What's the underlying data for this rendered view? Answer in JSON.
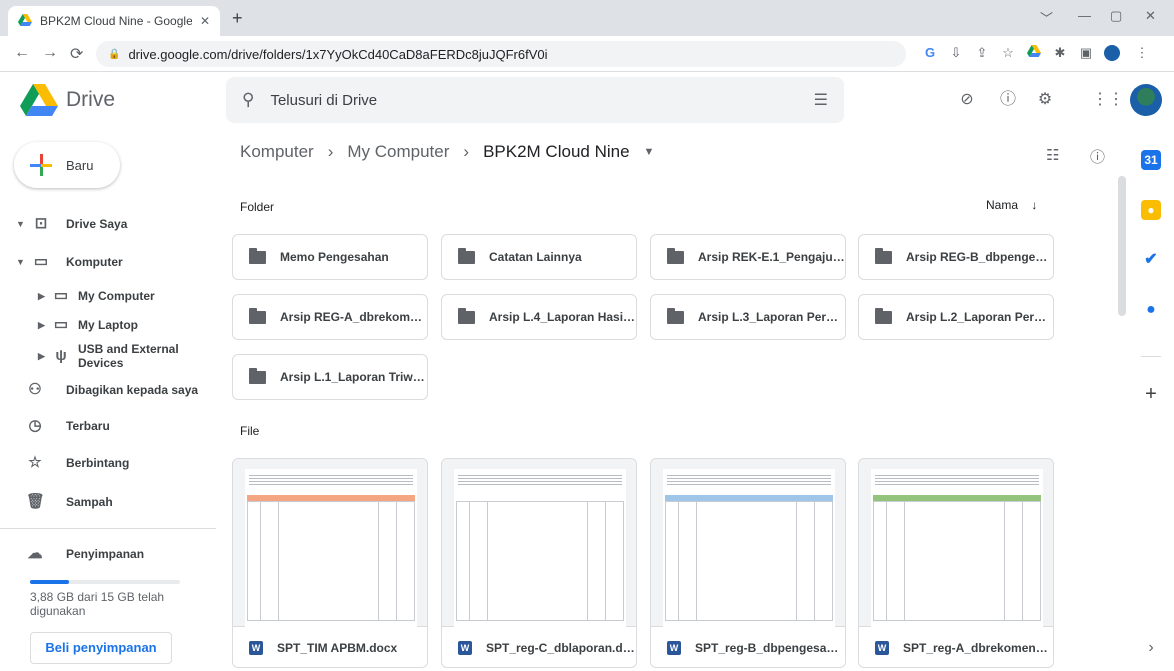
{
  "browser": {
    "tab_title": "BPK2M Cloud Nine - Google Drive",
    "tab_close": "✕",
    "new_tab": "+",
    "url": "drive.google.com/drive/folders/1x7YyOkCd40CaD8aFERDc8juJQFr6fV0i",
    "window_controls": [
      "﹀",
      "—",
      "▢",
      "✕"
    ]
  },
  "app": {
    "name": "Drive",
    "search_placeholder": "Telusuri di Drive"
  },
  "sidebar": {
    "new_button": "Baru",
    "items": [
      {
        "label": "Drive Saya",
        "icon": "my-drive-icon"
      },
      {
        "label": "Komputer",
        "icon": "computer-icon"
      },
      {
        "label": "My Computer",
        "icon": "laptop-icon"
      },
      {
        "label": "My Laptop",
        "icon": "laptop-icon"
      },
      {
        "label": "USB and External Devices",
        "icon": "usb-icon"
      },
      {
        "label": "Dibagikan kepada saya",
        "icon": "shared-icon"
      },
      {
        "label": "Terbaru",
        "icon": "clock-icon"
      },
      {
        "label": "Berbintang",
        "icon": "star-icon"
      },
      {
        "label": "Sampah",
        "icon": "trash-icon"
      },
      {
        "label": "Penyimpanan",
        "icon": "cloud-icon"
      }
    ],
    "storage_text": "3,88 GB dari 15 GB telah digunakan",
    "storage_used_fraction": 0.26,
    "buy_button": "Beli penyimpanan"
  },
  "main": {
    "breadcrumb": [
      "Komputer",
      "My Computer",
      "BPK2M Cloud Nine"
    ],
    "breadcrumb_sep": "›",
    "folder_section": "Folder",
    "file_section": "File",
    "sort_label": "Nama",
    "sort_arrow": "↓",
    "folders": [
      "Memo Pengesahan",
      "Catatan Lainnya",
      "Arsip REK-E.1_Pengajuan ...",
      "Arsip REG-B_dbpengesah...",
      "Arsip REG-A_dbrekomend...",
      "Arsip L.4_Laporan Hasil A...",
      "Arsip L.3_Laporan Permo...",
      "Arsip L.2_Laporan Permo...",
      "Arsip L.1_Laporan Triwulan"
    ],
    "files": [
      {
        "name": "SPT_TIM APBM.docx",
        "band_color": "#f4a582"
      },
      {
        "name": "SPT_reg-C_dblaporan.docx",
        "band_color": "#ffffff"
      },
      {
        "name": "SPT_reg-B_dbpengesaha...",
        "band_color": "#9fc5e8"
      },
      {
        "name": "SPT_reg-A_dbrekomenda...",
        "band_color": "#93c47d"
      }
    ],
    "file_type_badge": "W"
  },
  "colors": {
    "accent": "#1a73e8",
    "word": "#2b579a"
  }
}
